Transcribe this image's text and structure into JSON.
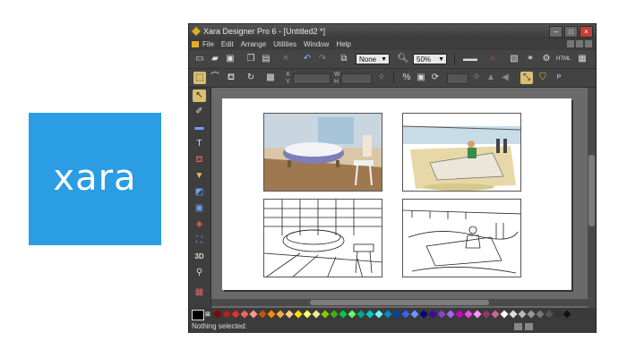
{
  "logo": {
    "text": "xara",
    "bg_color": "#2a9de4"
  },
  "window": {
    "title": "Xara Designer Pro 6 - [Untitled2 *]",
    "controls": [
      "minimize",
      "maximize",
      "close"
    ]
  },
  "menu": {
    "items": [
      "File",
      "Edit",
      "Arrange",
      "Utilities",
      "Window",
      "Help"
    ]
  },
  "toolbar": {
    "quality_value": "None",
    "zoom_value": "50%"
  },
  "infobar": {
    "fields": [
      {
        "label": "X"
      },
      {
        "label": "Y"
      },
      {
        "label": "W"
      },
      {
        "label": "H"
      }
    ]
  },
  "tools": [
    "selector-tool",
    "contour-tool",
    "rectangle-tool",
    "text-tool",
    "fill-tool",
    "transparency-tool",
    "shadow-tool",
    "bevel-tool",
    "blend-tool",
    "mould-tool",
    "3d-extrude-tool",
    "zoom-tool",
    "live-effects-tool"
  ],
  "tools_labels": {
    "3d": "3D"
  },
  "status": {
    "text": "Nothing selected:"
  },
  "palette_colors": [
    "#8b0000",
    "#b22222",
    "#e03030",
    "#ff6060",
    "#ff9999",
    "#cc5500",
    "#ff8800",
    "#ffaa44",
    "#ffcc88",
    "#ffe000",
    "#ffff66",
    "#eeee99",
    "#88cc00",
    "#44aa22",
    "#00cc44",
    "#66ff66",
    "#00aa88",
    "#00cccc",
    "#66ffff",
    "#0088cc",
    "#0044aa",
    "#3366ff",
    "#6699ff",
    "#000088",
    "#4400aa",
    "#8844cc",
    "#aa66ff",
    "#cc00cc",
    "#ff44ff",
    "#ff99ff",
    "#993366",
    "#cc6699",
    "#ffffff",
    "#dddddd",
    "#bbbbbb",
    "#999999",
    "#777777",
    "#555555",
    "#333333",
    "#111111"
  ]
}
